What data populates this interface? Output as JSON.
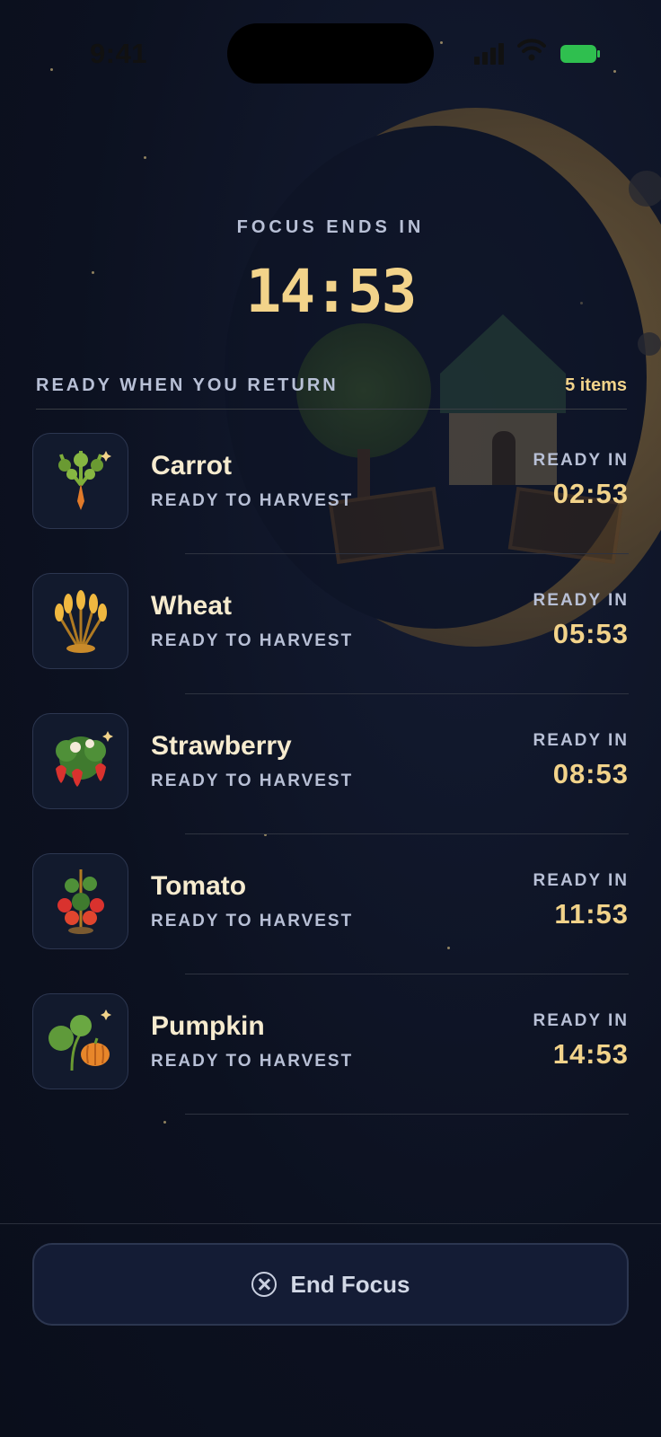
{
  "status_bar": {
    "time": "9:41"
  },
  "focus": {
    "label": "FOCUS ENDS IN",
    "remaining": "14:53"
  },
  "list": {
    "title": "READY WHEN YOU RETURN",
    "count": "5 items",
    "items": [
      {
        "name": "Carrot",
        "status": "READY TO HARVEST",
        "ready_label": "READY IN",
        "ready_time": "02:53",
        "icon": "carrot-icon"
      },
      {
        "name": "Wheat",
        "status": "READY TO HARVEST",
        "ready_label": "READY IN",
        "ready_time": "05:53",
        "icon": "wheat-icon"
      },
      {
        "name": "Strawberry",
        "status": "READY TO HARVEST",
        "ready_label": "READY IN",
        "ready_time": "08:53",
        "icon": "strawberry-icon"
      },
      {
        "name": "Tomato",
        "status": "READY TO HARVEST",
        "ready_label": "READY IN",
        "ready_time": "11:53",
        "icon": "tomato-icon"
      },
      {
        "name": "Pumpkin",
        "status": "READY TO HARVEST",
        "ready_label": "READY IN",
        "ready_time": "14:53",
        "icon": "pumpkin-icon"
      }
    ]
  },
  "end_button": {
    "label": "End Focus",
    "icon": "close-circle-icon"
  },
  "colors": {
    "accent": "#f2d38a",
    "background": "#0c1120",
    "muted": "#b8c0d6"
  }
}
